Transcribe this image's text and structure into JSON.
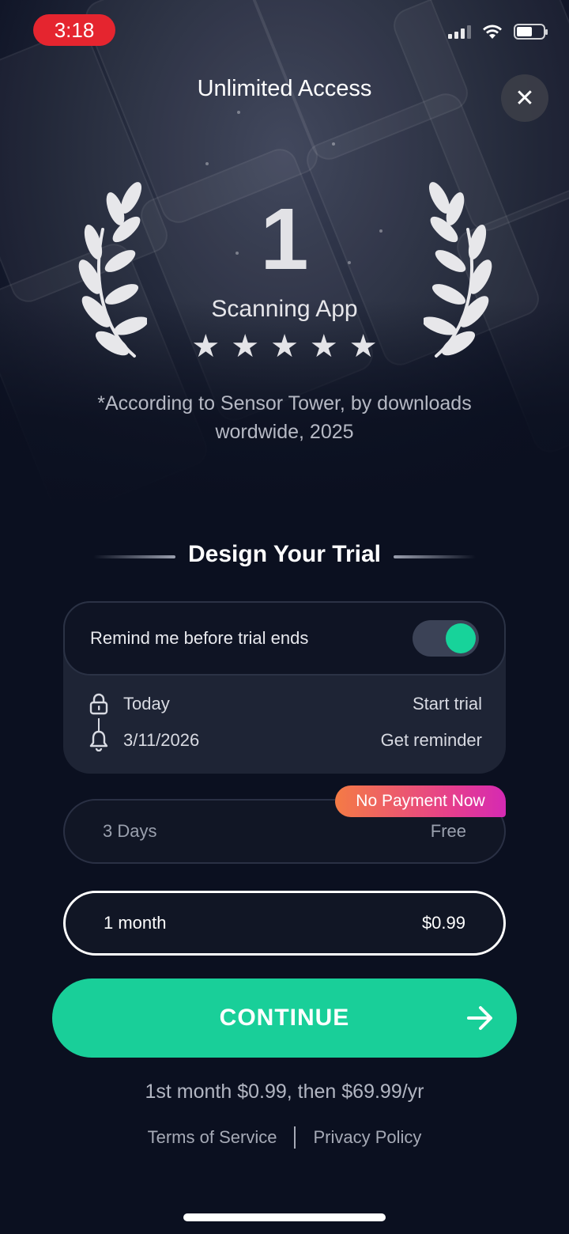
{
  "status_bar": {
    "time": "3:18"
  },
  "header": {
    "title": "Unlimited Access",
    "close_symbol": "✕"
  },
  "award": {
    "rank": "1",
    "label": "Scanning App",
    "rating_stars": 5,
    "source_note": "*According to Sensor Tower, by downloads wordwide, 2025"
  },
  "trial": {
    "section_title": "Design Your Trial",
    "reminder_label": "Remind me before trial ends",
    "reminder_enabled": true,
    "timeline": [
      {
        "date": "Today",
        "action": "Start trial",
        "icon": "lock-icon"
      },
      {
        "date": "3/11/2026",
        "action": "Get reminder",
        "icon": "bell-icon"
      }
    ]
  },
  "plans": [
    {
      "name": "3 Days",
      "price": "Free",
      "badge": "No Payment Now",
      "selected": false
    },
    {
      "name": "1 month",
      "price": "$0.99",
      "selected": true
    }
  ],
  "cta": {
    "label": "CONTINUE"
  },
  "footer": {
    "price_note": "1st month $0.99, then $69.99/yr",
    "terms_label": "Terms of Service",
    "privacy_label": "Privacy Policy"
  },
  "colors": {
    "accent": "#19cf99",
    "background": "#0b1020",
    "badge_start": "#f47b45",
    "badge_end": "#d52ab3"
  }
}
